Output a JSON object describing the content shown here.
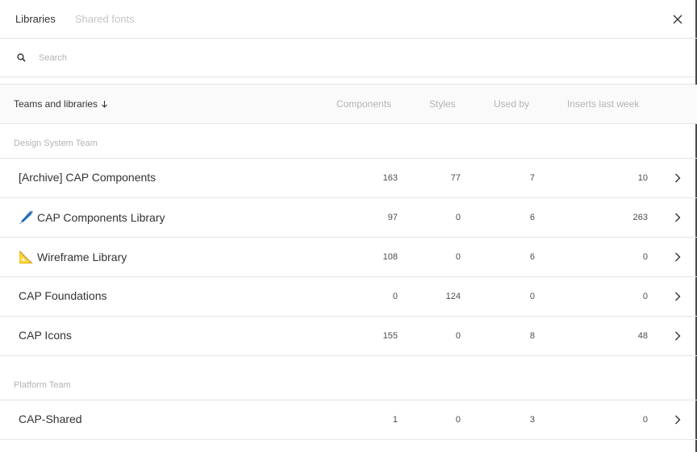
{
  "tabs": {
    "libraries": "Libraries",
    "shared_fonts": "Shared fonts"
  },
  "search": {
    "placeholder": "Search"
  },
  "columns": {
    "name": "Teams and libraries",
    "components": "Components",
    "styles": "Styles",
    "used_by": "Used by",
    "inserts": "Inserts last week"
  },
  "teams": [
    {
      "name": "Design System Team",
      "libraries": [
        {
          "emoji": "",
          "name": "[Archive] CAP Components",
          "components": "163",
          "styles": "77",
          "used_by": "7",
          "inserts": "10"
        },
        {
          "emoji": "🖊️",
          "name": "CAP Components Library",
          "components": "97",
          "styles": "0",
          "used_by": "6",
          "inserts": "263"
        },
        {
          "emoji": "📐",
          "name": "Wireframe Library",
          "components": "108",
          "styles": "0",
          "used_by": "6",
          "inserts": "0"
        },
        {
          "emoji": "",
          "name": "CAP Foundations",
          "components": "0",
          "styles": "124",
          "used_by": "0",
          "inserts": "0"
        },
        {
          "emoji": "",
          "name": "CAP Icons",
          "components": "155",
          "styles": "0",
          "used_by": "8",
          "inserts": "48"
        }
      ]
    },
    {
      "name": "Platform Team",
      "libraries": [
        {
          "emoji": "",
          "name": "CAP-Shared",
          "components": "1",
          "styles": "0",
          "used_by": "3",
          "inserts": "0"
        }
      ]
    }
  ],
  "icons": {
    "search": "search-icon",
    "close": "close-icon",
    "sort": "arrow-down-icon",
    "row_action": "chevron-right-icon"
  }
}
